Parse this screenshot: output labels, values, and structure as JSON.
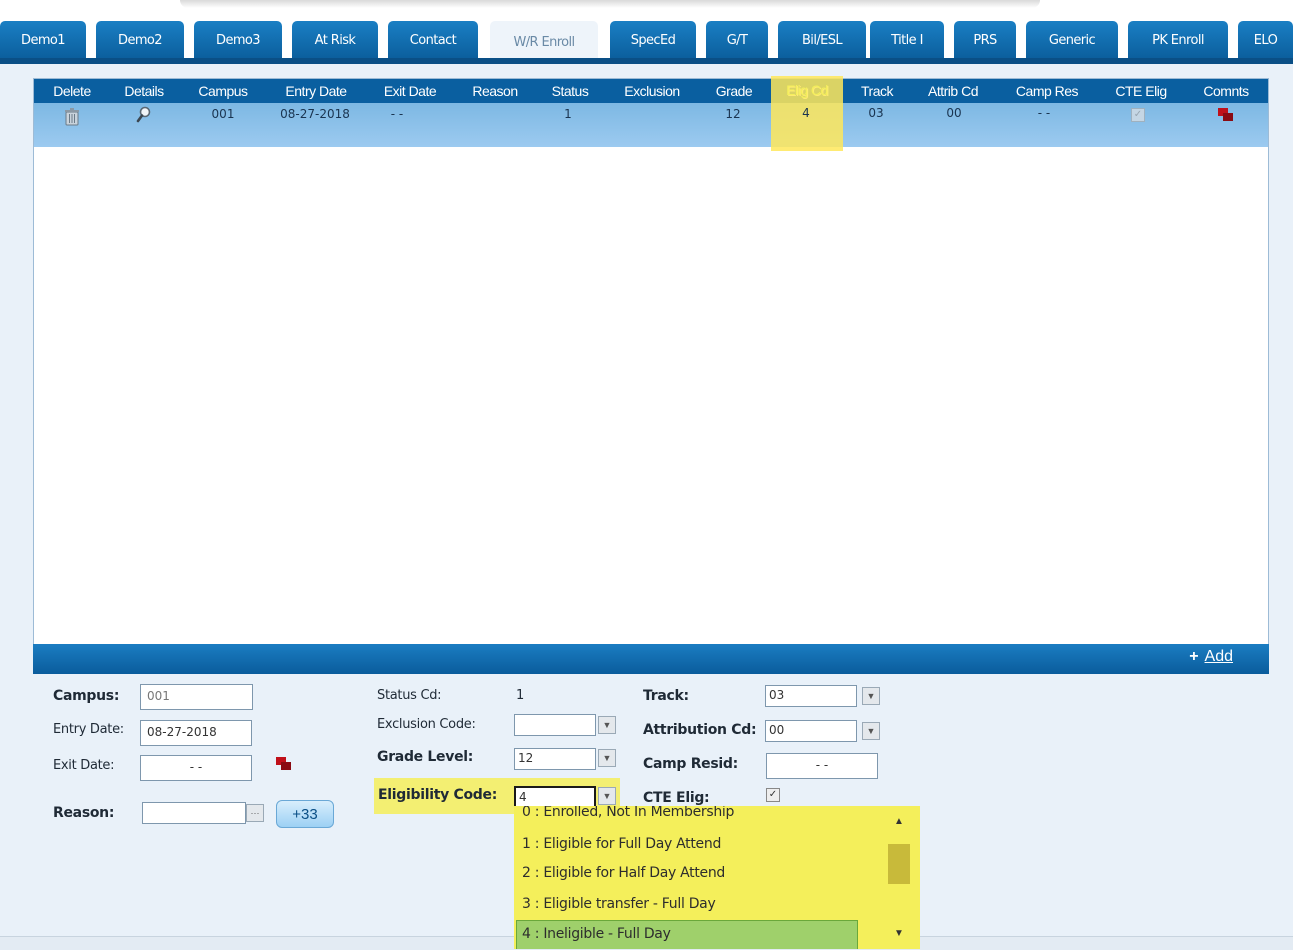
{
  "tabs": [
    {
      "label": "Demo1"
    },
    {
      "label": "Demo2"
    },
    {
      "label": "Demo3"
    },
    {
      "label": "At Risk"
    },
    {
      "label": "Contact"
    },
    {
      "label": "W/R Enroll",
      "active": true
    },
    {
      "label": "SpecEd"
    },
    {
      "label": "G/T"
    },
    {
      "label": "Bil/ESL"
    },
    {
      "label": "Title I"
    },
    {
      "label": "PRS"
    },
    {
      "label": "Generic"
    },
    {
      "label": "PK Enroll"
    },
    {
      "label": "ELO"
    }
  ],
  "grid": {
    "columns": [
      "Delete",
      "Details",
      "Campus",
      "Entry Date",
      "Exit Date",
      "Reason",
      "Status",
      "Exclusion",
      "Grade",
      "Elig Cd",
      "Track",
      "Attrib Cd",
      "Camp Res",
      "CTE Elig",
      "Comnts"
    ],
    "row": {
      "campus": "001",
      "entry_date": "08-27-2018",
      "exit_date": "- -",
      "reason": "",
      "status": "1",
      "exclusion": "",
      "grade": "12",
      "elig_cd": "4",
      "track": "03",
      "attrib_cd": "00",
      "camp_res": "- -",
      "cte_elig_checked": true
    },
    "highlight_column": "Elig Cd",
    "add_label": "Add",
    "add_symbol": "+"
  },
  "form": {
    "campus": {
      "label": "Campus:",
      "value": "001"
    },
    "entry_date": {
      "label": "Entry Date:",
      "value": "08-27-2018"
    },
    "exit_date": {
      "label": "Exit Date:",
      "value": "- -"
    },
    "reason": {
      "label": "Reason:",
      "value": "",
      "ellipsis": "···"
    },
    "plus_button": "+33",
    "status_cd": {
      "label": "Status Cd:",
      "value": "1"
    },
    "exclusion_code": {
      "label": "Exclusion Code:",
      "value": ""
    },
    "grade_level": {
      "label": "Grade Level:",
      "value": "12"
    },
    "eligibility_code": {
      "label": "Eligibility Code:",
      "value": "4"
    },
    "track": {
      "label": "Track:",
      "value": "03"
    },
    "attribution_cd": {
      "label": "Attribution Cd:",
      "value": "00"
    },
    "camp_resid": {
      "label": "Camp Resid:",
      "value": "- -"
    },
    "cte_elig": {
      "label": "CTE Elig:",
      "checked": true
    }
  },
  "eligibility_options": [
    "0 : Enrolled, Not In Membership",
    "1 : Eligible for Full Day Attend",
    "2 : Eligible for Half Day Attend",
    "3 : Eligible transfer - Full Day",
    "4 : Ineligible - Full Day"
  ],
  "selected_option_index": 4,
  "colors": {
    "tab_blue": "#0b5e9c",
    "highlight": "#f4ef5b",
    "selected": "#9fd06b",
    "header_blue": "#0a5fa0"
  }
}
